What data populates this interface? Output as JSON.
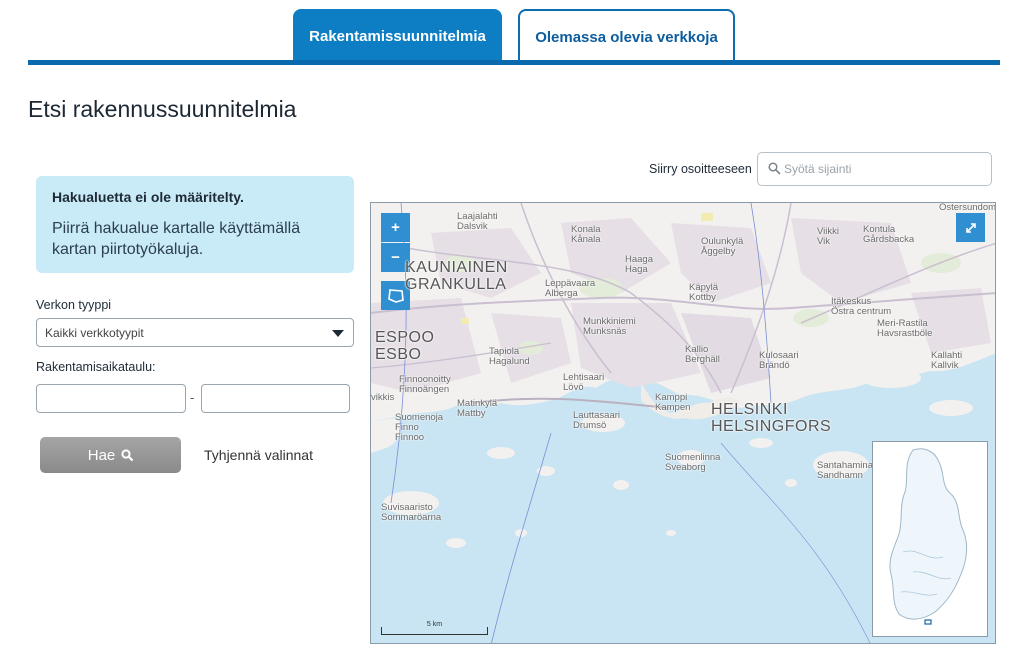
{
  "tabs": [
    {
      "label": "Rakentamissuunnitelmia",
      "active": true
    },
    {
      "label": "Olemassa olevia verkkoja",
      "active": false
    }
  ],
  "page_title": "Etsi rakennussuunnitelmia",
  "alert": {
    "title": "Hakualuetta ei ole määritelty.",
    "text": "Piirrä hakualue kartalle käyttämällä kartan piirtotyökaluja."
  },
  "filters": {
    "network_type_label": "Verkon tyyppi",
    "network_type_value": "Kaikki verkkotyypit",
    "schedule_label": "Rakentamisaikataulu:",
    "schedule_from": "",
    "schedule_to": "",
    "date_separator": "-"
  },
  "buttons": {
    "search_label": "Hae",
    "clear_label": "Tyhjennä valinnat"
  },
  "location": {
    "label": "Siirry osoitteeseen",
    "placeholder": "Syötä sijainti"
  },
  "map": {
    "zoom_in": "+",
    "zoom_out": "−",
    "scale_label": "5 km",
    "places": {
      "laajalahti": "Laajalahti\nDalsvik",
      "konala": "Konala\nKånala",
      "oulunkyla": "Oulunkylä\nÅggelby",
      "viikki": "Viikki\nVik",
      "kontula": "Kontula\nGårdsbacka",
      "ostersundom": "Östersundom",
      "kauniainen": "KAUNIAINEN\nGRANKULLA",
      "haaga": "Haaga\nHaga",
      "leppavaara": "Leppävaara\nAlberga",
      "kapyla": "Käpylä\nKottby",
      "itakeskus": "Itäkeskus\nÖstra centrum",
      "munkkiniemi": "Munkkiniemi\nMunksnäs",
      "merirastila": "Meri-Rastila\nHavsrastböle",
      "espoo": "ESPOO\nESBO",
      "tapiola": "Tapiola\nHagalund",
      "kallio": "Kallio\nBerghäll",
      "kulosaari": "Kulosaari\nBrändö",
      "kallahti": "Kallahti\nKallvik",
      "finnoo": "Finnoonoitty\nFinnoängen",
      "lehtisaari": "Lehtisaari\nLövö",
      "kamppi": "Kamppi\nKampen",
      "matinkyla": "Matinkylä\nMattby",
      "suomenoja": "Suomenoja\nFinno\nFinnoo",
      "lauttasaari": "Lauttasaari\nDrumsö",
      "helsinki": "HELSINKI\nHELSINGFORS",
      "suomenlinna": "Suomenlinna\nSveaborg",
      "santahamina": "Santahamina\nSandhamn",
      "suvisaaristo": "Suvisaaristo\nSommaröarna",
      "vikkis": "vikkis"
    }
  },
  "colors": {
    "tab_active": "#0d7ec4",
    "tab_rule": "#0b69ad",
    "alert_bg": "#c9ebf7",
    "map_control": "#2f8fd1",
    "sea": "#c9e4f2",
    "land": "#f3f1ef"
  },
  "icons": {
    "search": "magnifier-icon",
    "fullscreen": "expand-icon",
    "draw": "polygon-draw-icon",
    "dropdown": "chevron-down-icon"
  }
}
